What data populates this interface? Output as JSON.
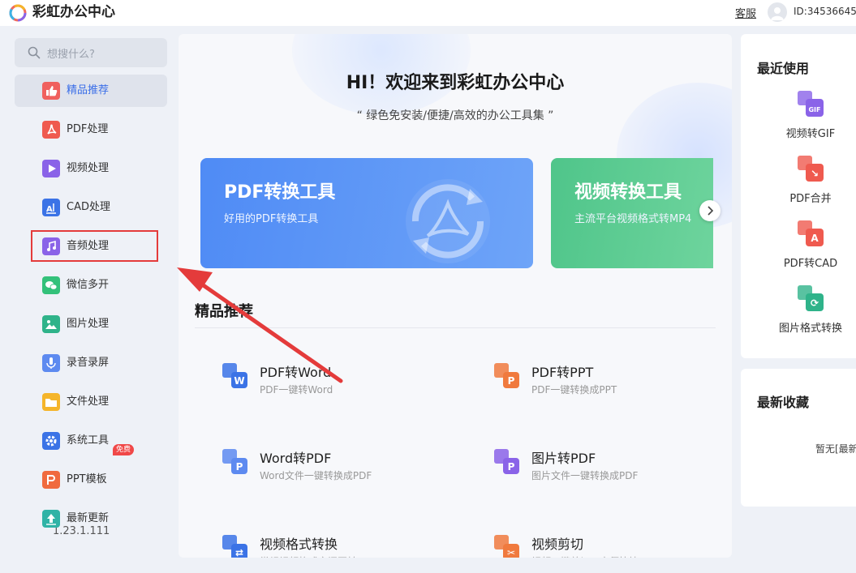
{
  "app": {
    "title": "彩虹办公中心",
    "service_label": "客服",
    "user_id": "ID:34536645"
  },
  "sidebar": {
    "search_placeholder": "想搜什么?",
    "items": [
      {
        "label": "精品推荐",
        "icon": "thumbs-up-icon",
        "color": "#f0605e"
      },
      {
        "label": "PDF处理",
        "icon": "pdf-icon",
        "color": "#ef5a4f"
      },
      {
        "label": "视频处理",
        "icon": "play-icon",
        "color": "#8a63e8"
      },
      {
        "label": "CAD处理",
        "icon": "cad-icon",
        "color": "#3b73e6"
      },
      {
        "label": "音频处理",
        "icon": "music-icon",
        "color": "#8a63e8"
      },
      {
        "label": "微信多开",
        "icon": "wechat-icon",
        "color": "#33c17a"
      },
      {
        "label": "图片处理",
        "icon": "image-icon",
        "color": "#2fb38a"
      },
      {
        "label": "录音录屏",
        "icon": "microphone-icon",
        "color": "#5d8af0"
      },
      {
        "label": "文件处理",
        "icon": "folder-icon",
        "color": "#f5b52a"
      },
      {
        "label": "系统工具",
        "icon": "gear-icon",
        "color": "#3b73e6"
      },
      {
        "label": "PPT模板",
        "icon": "ppt-icon",
        "color": "#f06a3e"
      },
      {
        "label": "最新更新",
        "icon": "upload-icon",
        "color": "#2fb3a6"
      }
    ],
    "free_badge": "免费",
    "version": "1.23.1.111"
  },
  "main": {
    "title": "HI！欢迎来到彩虹办公中心",
    "subtitle": "“ 绿色免安装/便捷/高效的办公工具集 ”",
    "banners": [
      {
        "title": "PDF转换工具",
        "desc": "好用的PDF转换工具"
      },
      {
        "title": "视频转换工具",
        "desc": "主流平台视频格式转MP4"
      }
    ],
    "section_title": "精品推荐",
    "tools": [
      {
        "name": "PDF转Word",
        "desc": "PDF一键转Word",
        "icon": "pdf-to-word-icon",
        "color": "#3b73e6"
      },
      {
        "name": "PDF转PPT",
        "desc": "PDF一键转换成PPT",
        "icon": "pdf-to-ppt-icon",
        "color": "#f07a3e"
      },
      {
        "name": "Word转PDF",
        "desc": "Word文件一键转换成PDF",
        "icon": "word-to-pdf-icon",
        "color": "#5d8af0"
      },
      {
        "name": "图片转PDF",
        "desc": "图片文件一键转换成PDF",
        "icon": "image-to-pdf-icon",
        "color": "#8a63e8"
      },
      {
        "name": "视频格式转换",
        "desc": "常规视频格式之间互转",
        "icon": "video-convert-icon",
        "color": "#3b73e6"
      },
      {
        "name": "视频剪切",
        "desc": "视频一键剪切，方便快捷",
        "icon": "video-cut-icon",
        "color": "#f07a3e"
      }
    ]
  },
  "recent": {
    "title": "最近使用",
    "items": [
      {
        "label": "视频转GIF",
        "icon": "video-to-gif-icon",
        "color": "#8a63e8"
      },
      {
        "label": "PDF合并",
        "icon": "pdf-merge-icon",
        "color": "#ef5a4f"
      },
      {
        "label": "PDF转CAD",
        "icon": "pdf-to-cad-icon",
        "color": "#ef5a4f"
      },
      {
        "label": "图片格式转换",
        "icon": "image-convert-icon",
        "color": "#2fb38a"
      }
    ]
  },
  "favorites": {
    "title": "最新收藏",
    "empty_text": "暂无[最新收藏]"
  }
}
